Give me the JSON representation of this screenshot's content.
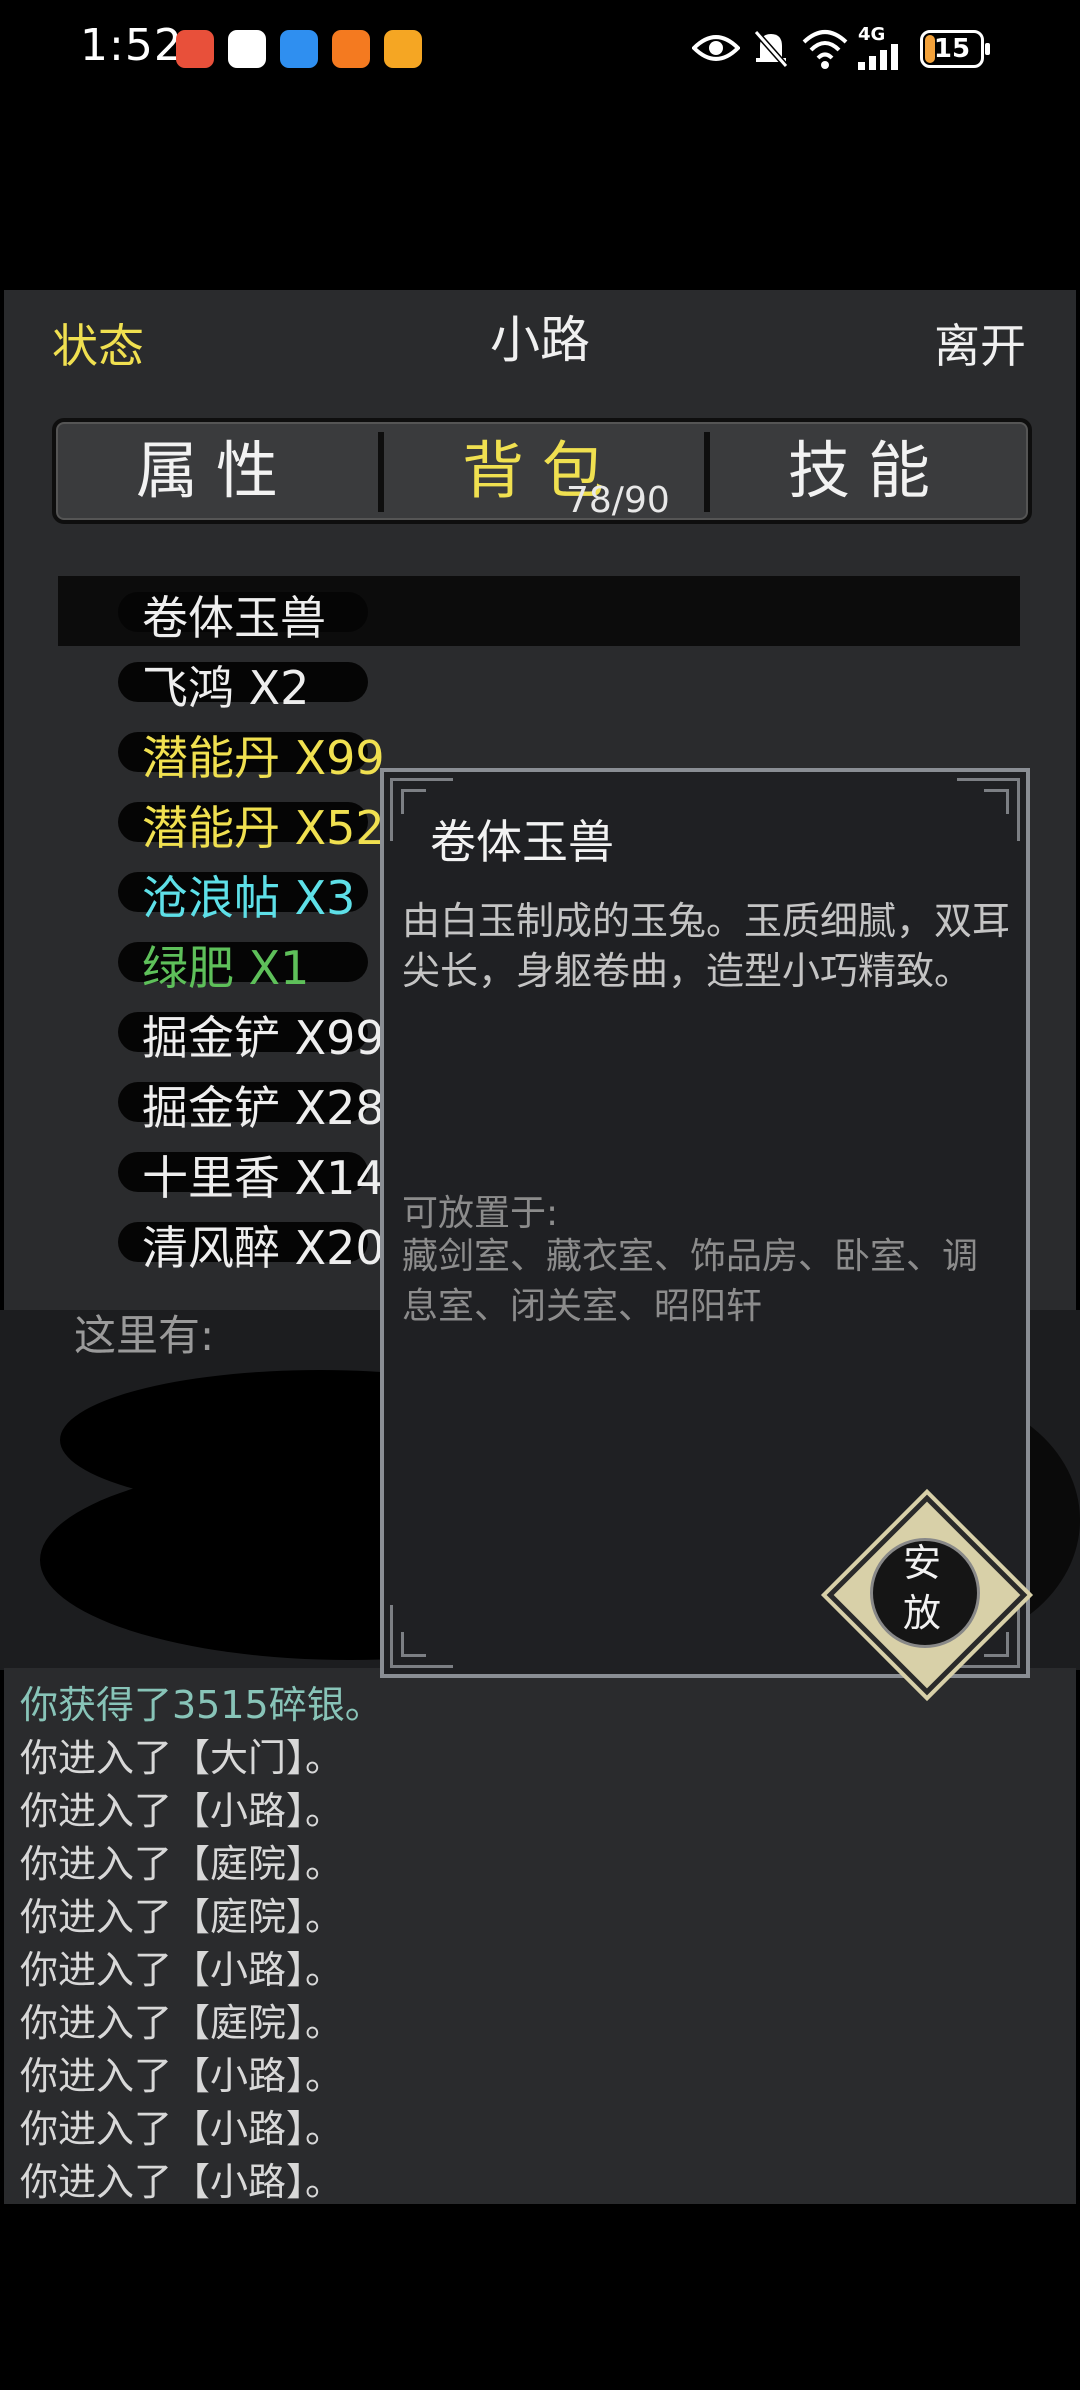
{
  "status_bar": {
    "time": "1:52",
    "network": "4G",
    "battery": "15",
    "notification_icons": [
      "missed-call-icon",
      "qq-icon",
      "message-icon",
      "taobao-flash-icon",
      "coupon-app-icon"
    ],
    "status_icons": [
      "eye-comfort-icon",
      "mute-icon",
      "wifi-icon",
      "signal-icon"
    ]
  },
  "header": {
    "status_label": "状态",
    "location_title": "小路",
    "leave_label": "离开"
  },
  "tabs": {
    "attributes": "属性",
    "bag": "背包",
    "skills": "技能",
    "bag_count": "78/90"
  },
  "bag_items": [
    {
      "name": "卷体玉兽",
      "color": "#eeeeee"
    },
    {
      "name": "飞鸿 X2",
      "color": "#eeeeee"
    },
    {
      "name": "潜能丹 X99",
      "color": "#f0e050"
    },
    {
      "name": "潜能丹 X52",
      "color": "#f0e050"
    },
    {
      "name": "沧浪帖 X3",
      "color": "#5ee0e8"
    },
    {
      "name": "绿肥 X1",
      "color": "#5ec05a"
    },
    {
      "name": "掘金铲 X99",
      "color": "#eeeeee"
    },
    {
      "name": "掘金铲 X28",
      "color": "#eeeeee"
    },
    {
      "name": "十里香 X14",
      "color": "#eeeeee"
    },
    {
      "name": "清风醉 X20",
      "color": "#eeeeee"
    }
  ],
  "scene": {
    "here_label": "这里有:"
  },
  "popup": {
    "title": "卷体玉兽",
    "description": "由白玉制成的玉兔。玉质细腻，双耳尖长，身躯卷曲，造型小巧精致。",
    "placeable_label": "可放置于:",
    "placeable_rooms": "藏剑室、藏衣室、饰品房、卧室、调息室、闭关室、昭阳轩",
    "place_button_line1": "安",
    "place_button_line2": "放"
  },
  "log": [
    "你获得了3515碎银。",
    "你进入了【大门】。",
    "你进入了【小路】。",
    "你进入了【庭院】。",
    "你进入了【庭院】。",
    "你进入了【小路】。",
    "你进入了【庭院】。",
    "你进入了【小路】。",
    "你进入了【小路】。",
    "你进入了【小路】。"
  ]
}
